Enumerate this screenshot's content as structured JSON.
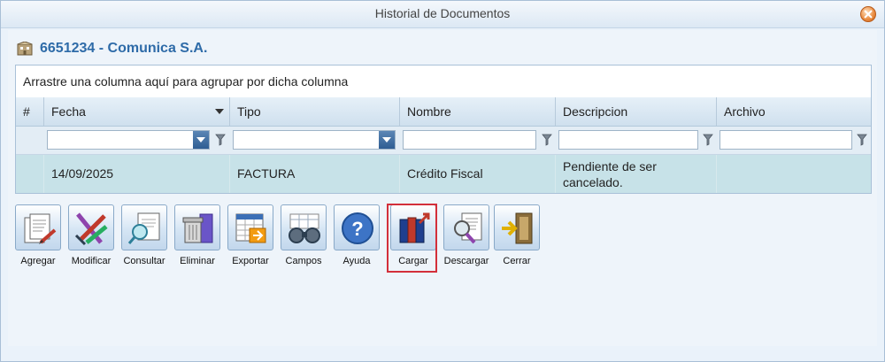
{
  "window": {
    "title": "Historial de Documentos"
  },
  "header": {
    "company": "6651234 - Comunica S.A."
  },
  "grid": {
    "group_panel": "Arrastre una columna aquí para agrupar por dicha columna",
    "columns": [
      "#",
      "Fecha",
      "Tipo",
      "Nombre",
      "Descripcion",
      "Archivo"
    ],
    "rows": [
      {
        "num": "",
        "fecha": "14/09/2025",
        "tipo": "FACTURA",
        "nombre": "Crédito Fiscal",
        "descripcion": "Pendiente de ser cancelado.",
        "archivo": ""
      }
    ]
  },
  "toolbar": {
    "buttons": [
      {
        "label": "Agregar",
        "icon": "add-document-icon"
      },
      {
        "label": "Modificar",
        "icon": "edit-pencils-icon"
      },
      {
        "label": "Consultar",
        "icon": "search-document-icon"
      },
      {
        "label": "Eliminar",
        "icon": "trash-can-icon"
      },
      {
        "label": "Exportar",
        "icon": "export-spreadsheet-icon"
      },
      {
        "label": "Campos",
        "icon": "binoculars-icon"
      },
      {
        "label": "Ayuda",
        "icon": "help-icon"
      },
      {
        "label": "Cargar",
        "icon": "upload-binders-icon"
      },
      {
        "label": "Descargar",
        "icon": "download-magnifier-icon"
      },
      {
        "label": "Cerrar",
        "icon": "exit-door-icon"
      }
    ],
    "highlighted": "Cargar"
  },
  "colors": {
    "accent": "#2e6ba8",
    "row_bg": "#c7e2e8",
    "highlight": "#d32f3a"
  }
}
